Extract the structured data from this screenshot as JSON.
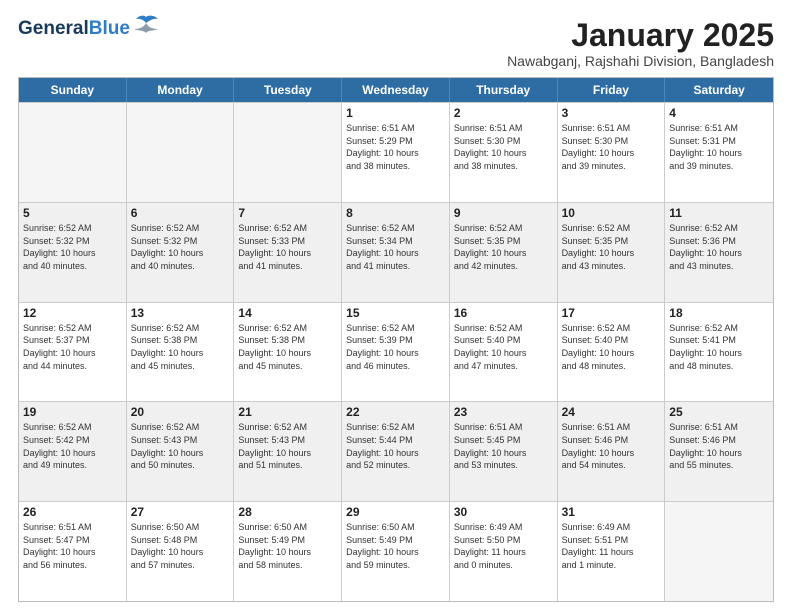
{
  "header": {
    "logo_line1": "General",
    "logo_line2": "Blue",
    "title": "January 2025",
    "subtitle": "Nawabganj, Rajshahi Division, Bangladesh"
  },
  "weekdays": [
    "Sunday",
    "Monday",
    "Tuesday",
    "Wednesday",
    "Thursday",
    "Friday",
    "Saturday"
  ],
  "weeks": [
    [
      {
        "day": "",
        "info": "",
        "empty": true
      },
      {
        "day": "",
        "info": "",
        "empty": true
      },
      {
        "day": "",
        "info": "",
        "empty": true
      },
      {
        "day": "1",
        "info": "Sunrise: 6:51 AM\nSunset: 5:29 PM\nDaylight: 10 hours\nand 38 minutes.",
        "empty": false
      },
      {
        "day": "2",
        "info": "Sunrise: 6:51 AM\nSunset: 5:30 PM\nDaylight: 10 hours\nand 38 minutes.",
        "empty": false
      },
      {
        "day": "3",
        "info": "Sunrise: 6:51 AM\nSunset: 5:30 PM\nDaylight: 10 hours\nand 39 minutes.",
        "empty": false
      },
      {
        "day": "4",
        "info": "Sunrise: 6:51 AM\nSunset: 5:31 PM\nDaylight: 10 hours\nand 39 minutes.",
        "empty": false
      }
    ],
    [
      {
        "day": "5",
        "info": "Sunrise: 6:52 AM\nSunset: 5:32 PM\nDaylight: 10 hours\nand 40 minutes.",
        "empty": false
      },
      {
        "day": "6",
        "info": "Sunrise: 6:52 AM\nSunset: 5:32 PM\nDaylight: 10 hours\nand 40 minutes.",
        "empty": false
      },
      {
        "day": "7",
        "info": "Sunrise: 6:52 AM\nSunset: 5:33 PM\nDaylight: 10 hours\nand 41 minutes.",
        "empty": false
      },
      {
        "day": "8",
        "info": "Sunrise: 6:52 AM\nSunset: 5:34 PM\nDaylight: 10 hours\nand 41 minutes.",
        "empty": false
      },
      {
        "day": "9",
        "info": "Sunrise: 6:52 AM\nSunset: 5:35 PM\nDaylight: 10 hours\nand 42 minutes.",
        "empty": false
      },
      {
        "day": "10",
        "info": "Sunrise: 6:52 AM\nSunset: 5:35 PM\nDaylight: 10 hours\nand 43 minutes.",
        "empty": false
      },
      {
        "day": "11",
        "info": "Sunrise: 6:52 AM\nSunset: 5:36 PM\nDaylight: 10 hours\nand 43 minutes.",
        "empty": false
      }
    ],
    [
      {
        "day": "12",
        "info": "Sunrise: 6:52 AM\nSunset: 5:37 PM\nDaylight: 10 hours\nand 44 minutes.",
        "empty": false
      },
      {
        "day": "13",
        "info": "Sunrise: 6:52 AM\nSunset: 5:38 PM\nDaylight: 10 hours\nand 45 minutes.",
        "empty": false
      },
      {
        "day": "14",
        "info": "Sunrise: 6:52 AM\nSunset: 5:38 PM\nDaylight: 10 hours\nand 45 minutes.",
        "empty": false
      },
      {
        "day": "15",
        "info": "Sunrise: 6:52 AM\nSunset: 5:39 PM\nDaylight: 10 hours\nand 46 minutes.",
        "empty": false
      },
      {
        "day": "16",
        "info": "Sunrise: 6:52 AM\nSunset: 5:40 PM\nDaylight: 10 hours\nand 47 minutes.",
        "empty": false
      },
      {
        "day": "17",
        "info": "Sunrise: 6:52 AM\nSunset: 5:40 PM\nDaylight: 10 hours\nand 48 minutes.",
        "empty": false
      },
      {
        "day": "18",
        "info": "Sunrise: 6:52 AM\nSunset: 5:41 PM\nDaylight: 10 hours\nand 48 minutes.",
        "empty": false
      }
    ],
    [
      {
        "day": "19",
        "info": "Sunrise: 6:52 AM\nSunset: 5:42 PM\nDaylight: 10 hours\nand 49 minutes.",
        "empty": false
      },
      {
        "day": "20",
        "info": "Sunrise: 6:52 AM\nSunset: 5:43 PM\nDaylight: 10 hours\nand 50 minutes.",
        "empty": false
      },
      {
        "day": "21",
        "info": "Sunrise: 6:52 AM\nSunset: 5:43 PM\nDaylight: 10 hours\nand 51 minutes.",
        "empty": false
      },
      {
        "day": "22",
        "info": "Sunrise: 6:52 AM\nSunset: 5:44 PM\nDaylight: 10 hours\nand 52 minutes.",
        "empty": false
      },
      {
        "day": "23",
        "info": "Sunrise: 6:51 AM\nSunset: 5:45 PM\nDaylight: 10 hours\nand 53 minutes.",
        "empty": false
      },
      {
        "day": "24",
        "info": "Sunrise: 6:51 AM\nSunset: 5:46 PM\nDaylight: 10 hours\nand 54 minutes.",
        "empty": false
      },
      {
        "day": "25",
        "info": "Sunrise: 6:51 AM\nSunset: 5:46 PM\nDaylight: 10 hours\nand 55 minutes.",
        "empty": false
      }
    ],
    [
      {
        "day": "26",
        "info": "Sunrise: 6:51 AM\nSunset: 5:47 PM\nDaylight: 10 hours\nand 56 minutes.",
        "empty": false
      },
      {
        "day": "27",
        "info": "Sunrise: 6:50 AM\nSunset: 5:48 PM\nDaylight: 10 hours\nand 57 minutes.",
        "empty": false
      },
      {
        "day": "28",
        "info": "Sunrise: 6:50 AM\nSunset: 5:49 PM\nDaylight: 10 hours\nand 58 minutes.",
        "empty": false
      },
      {
        "day": "29",
        "info": "Sunrise: 6:50 AM\nSunset: 5:49 PM\nDaylight: 10 hours\nand 59 minutes.",
        "empty": false
      },
      {
        "day": "30",
        "info": "Sunrise: 6:49 AM\nSunset: 5:50 PM\nDaylight: 11 hours\nand 0 minutes.",
        "empty": false
      },
      {
        "day": "31",
        "info": "Sunrise: 6:49 AM\nSunset: 5:51 PM\nDaylight: 11 hours\nand 1 minute.",
        "empty": false
      },
      {
        "day": "",
        "info": "",
        "empty": true
      }
    ]
  ]
}
